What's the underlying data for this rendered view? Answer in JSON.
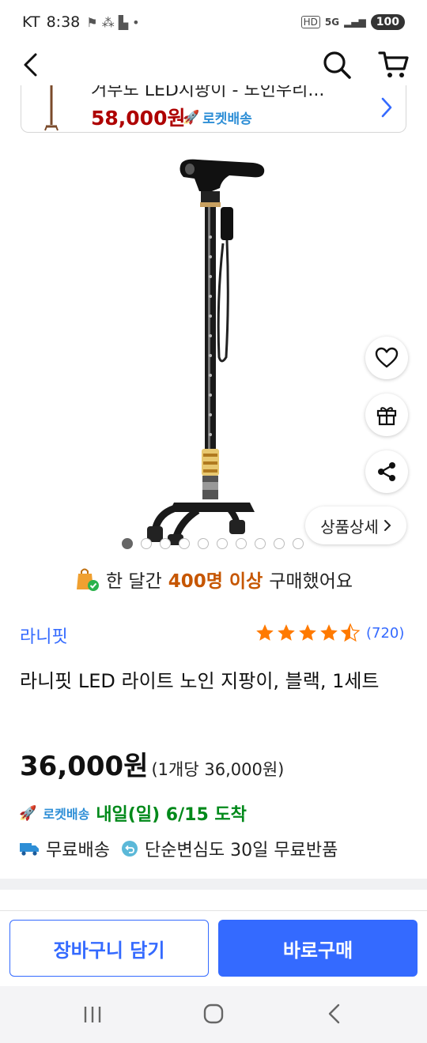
{
  "status_bar": {
    "carrier": "KT",
    "time": "8:38",
    "network": "5G",
    "battery": "100"
  },
  "related": {
    "title": "거무도 LED지팡이 - 노인우리...",
    "price": "58,000원",
    "rocket_label": "로켓배송"
  },
  "gallery": {
    "detail_label": "상품상세",
    "total_images": 10,
    "current_index": 1
  },
  "purchase_stat": {
    "prefix": "한 달간",
    "highlight": "400명 이상",
    "suffix": "구매했어요"
  },
  "product": {
    "brand": "라니핏",
    "rating": 4.5,
    "review_count": "(720)",
    "title": "라니핏 LED 라이트 노인 지팡이, 블랙, 1세트",
    "price": "36,000원",
    "unit_price": "(1개당 36,000원)"
  },
  "delivery": {
    "rocket_label": "로켓배송",
    "arrival": "내일(일) 6/15 도착",
    "free_shipping": "무료배송",
    "return_policy": "단순변심도 30일 무료반품"
  },
  "actions": {
    "add_to_cart": "장바구니 담기",
    "buy_now": "바로구매"
  },
  "colors": {
    "accent_blue": "#346aff",
    "price_red": "#ae0000",
    "arrival_green": "#00891a",
    "highlight_orange": "#c65600",
    "star_orange": "#ff7a00"
  }
}
